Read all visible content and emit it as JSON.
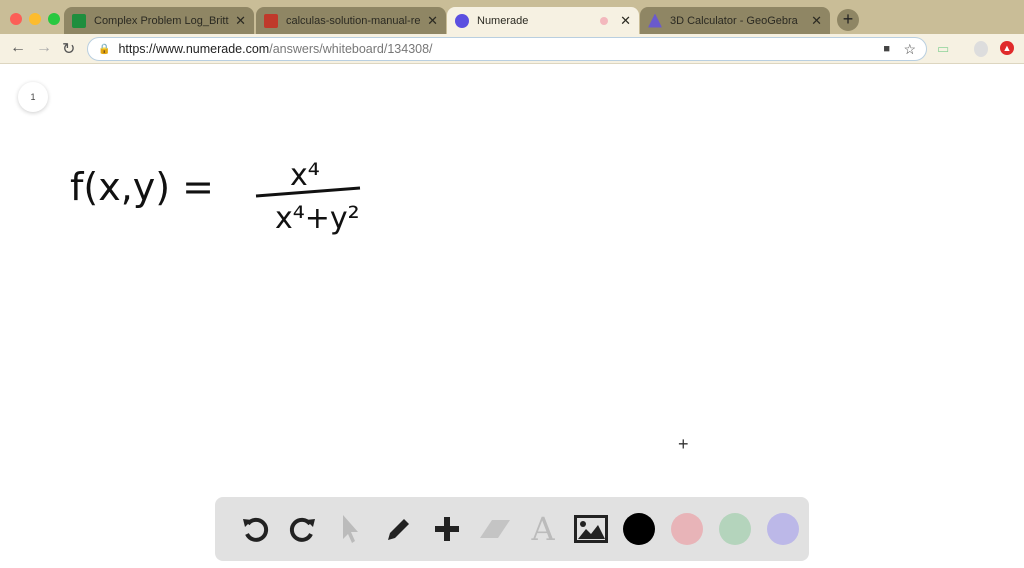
{
  "browser": {
    "tabs": [
      {
        "title": "Complex Problem Log_Brittany",
        "active": false,
        "favicon_color": "#1e8e3e"
      },
      {
        "title": "calculas-solution-manual-real",
        "active": false,
        "favicon_color": "#c0392b"
      },
      {
        "title": "Numerade",
        "active": true,
        "favicon_color": "#5b4fe0"
      },
      {
        "title": "3D Calculator - GeoGebra",
        "active": false,
        "favicon_color": "#6a5acd"
      }
    ],
    "url_host": "https://www.numerade.com",
    "url_path": "/answers/whiteboard/134308/"
  },
  "whiteboard": {
    "page_number": "1",
    "lhs": "f(x,y) =",
    "numerator": "x⁴",
    "denominator": "x⁴+y²"
  },
  "toolbar": {
    "tools": [
      "undo-icon",
      "redo-icon",
      "select-icon",
      "pencil-icon",
      "plus-icon",
      "eraser-icon",
      "text-icon",
      "image-icon"
    ],
    "colors": [
      "#000000",
      "#e8b4b8",
      "#b4d4bc",
      "#bcb8e8"
    ]
  }
}
